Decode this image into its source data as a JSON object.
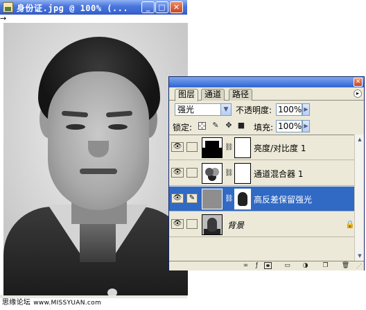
{
  "document_window": {
    "title": "身份证.jpg @ 100% (...",
    "minimize_symbol": "_",
    "maximize_symbol": "□",
    "close_symbol": "✕"
  },
  "watermark": {
    "text": "思缘论坛",
    "url": "www.MISSYUAN.com"
  },
  "layers_panel": {
    "close_symbol": "✕",
    "menu_symbol": "▸",
    "tabs": [
      {
        "label": "图层",
        "active": true
      },
      {
        "label": "通道",
        "active": false
      },
      {
        "label": "路径",
        "active": false
      }
    ],
    "blend_mode": "强光",
    "opacity_label": "不透明度:",
    "opacity_value": "100%",
    "lock_label": "锁定:",
    "fill_label": "填充:",
    "fill_value": "100%",
    "layers": [
      {
        "name": "亮度/对比度 1",
        "visible": true,
        "selected": false,
        "type": "adjustment"
      },
      {
        "name": "通道混合器 1",
        "visible": true,
        "selected": false,
        "type": "adjustment"
      },
      {
        "name": "高反差保留强光",
        "visible": true,
        "selected": true,
        "type": "layer-with-mask"
      },
      {
        "name": "背景",
        "visible": true,
        "selected": false,
        "type": "background",
        "locked": true
      }
    ],
    "bottom_icons": [
      "link-layers-icon",
      "layer-style-icon",
      "add-mask-icon",
      "new-group-icon",
      "adjustment-layer-icon",
      "new-layer-icon",
      "delete-layer-icon"
    ]
  },
  "colors": {
    "selection": "#316ac5",
    "title_bar": "#3562d0",
    "panel_bg": "#ece9d8"
  }
}
